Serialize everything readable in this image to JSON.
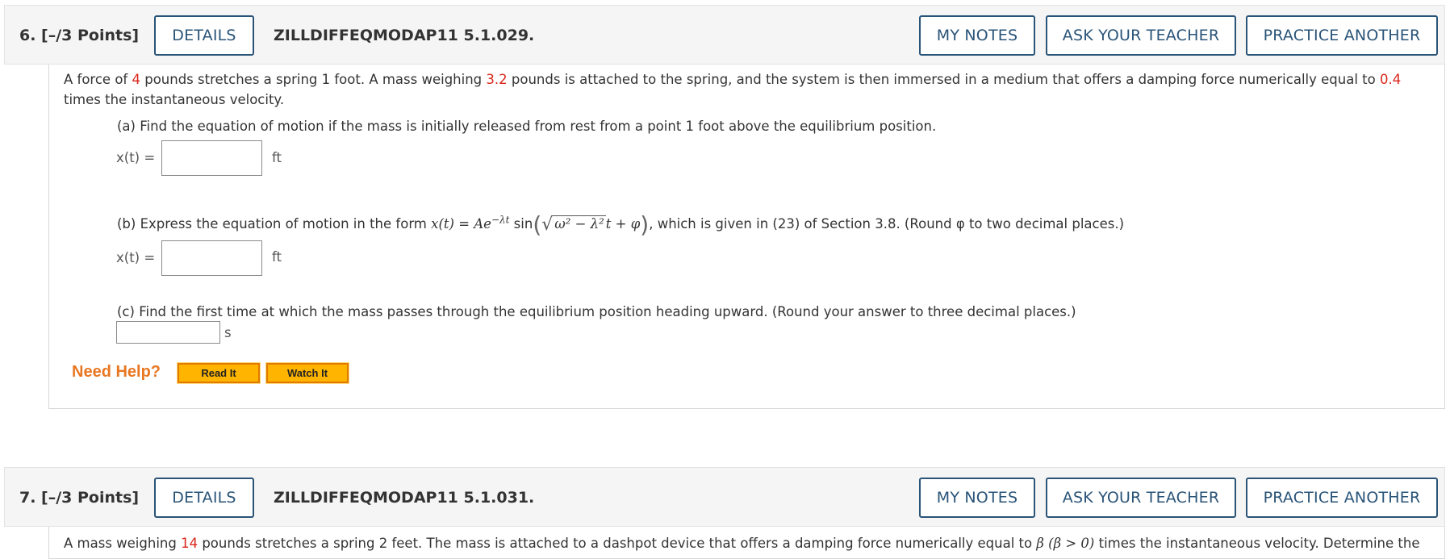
{
  "buttons": {
    "details": "DETAILS",
    "my_notes": "MY NOTES",
    "ask_teacher": "ASK YOUR TEACHER",
    "practice_another": "PRACTICE ANOTHER"
  },
  "q6": {
    "number": "6.  [–/3 Points]",
    "code": "ZILLDIFFEQMODAP11 5.1.029.",
    "intro": {
      "t1": "A force of ",
      "v1": "4",
      "t2": " pounds stretches a spring 1 foot. A mass weighing ",
      "v2": "3.2",
      "t3": " pounds is attached to the spring, and the system is then immersed in a medium that offers a damping force numerically equal to ",
      "v3": "0.4",
      "line2": "times the instantaneous velocity."
    },
    "part_a": {
      "prompt": "(a) Find the equation of motion if the mass is initially released from rest from a point 1 foot above the equilibrium position.",
      "label": "x(t) =",
      "value": "",
      "unit": "ft"
    },
    "part_b": {
      "prompt_start": "(b) Express the equation of motion in the form ",
      "formula_lhs": "x(t) = Ae",
      "formula_exp": "−λt",
      "formula_sin": " sin",
      "formula_root": "ω² − λ²",
      "formula_tail": "t + φ",
      "prompt_end": ", which is given in (23) of Section 3.8. (Round φ to two decimal places.)",
      "label": "x(t) =",
      "value": "",
      "unit": "ft"
    },
    "part_c": {
      "prompt": "(c) Find the first time at which the mass passes through the equilibrium position heading upward. (Round your answer to three decimal places.)",
      "value": "",
      "unit": "s"
    },
    "help": {
      "label": "Need Help?",
      "read_it": "Read It",
      "watch_it": "Watch It"
    }
  },
  "q7": {
    "number": "7.  [–/3 Points]",
    "code": "ZILLDIFFEQMODAP11 5.1.031.",
    "intro": {
      "t1": "A mass weighing ",
      "v1": "14",
      "t2": " pounds stretches a spring 2 feet. The mass is attached to a dashpot device that offers a damping force numerically equal to ",
      "beta": "β (β > 0)",
      "t3": " times the instantaneous velocity. Determine the"
    }
  },
  "colors": {
    "button_border": "#2a5478",
    "highlight_value": "#d9261c",
    "need_help": "#e87722",
    "help_button": "#ffb400"
  }
}
